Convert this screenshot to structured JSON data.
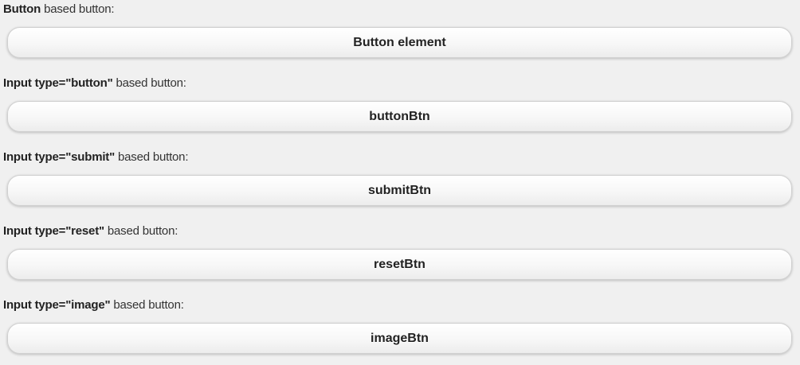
{
  "sections": [
    {
      "label_bold": "Button",
      "label_rest": " based button:",
      "button_label": "Button element"
    },
    {
      "label_bold": "Input type=\"button\"",
      "label_rest": " based button:",
      "button_label": "buttonBtn"
    },
    {
      "label_bold": "Input type=\"submit\"",
      "label_rest": " based button:",
      "button_label": "submitBtn"
    },
    {
      "label_bold": "Input type=\"reset\"",
      "label_rest": " based button:",
      "button_label": "resetBtn"
    },
    {
      "label_bold": "Input type=\"image\"",
      "label_rest": " based button:",
      "button_label": "imageBtn"
    }
  ]
}
